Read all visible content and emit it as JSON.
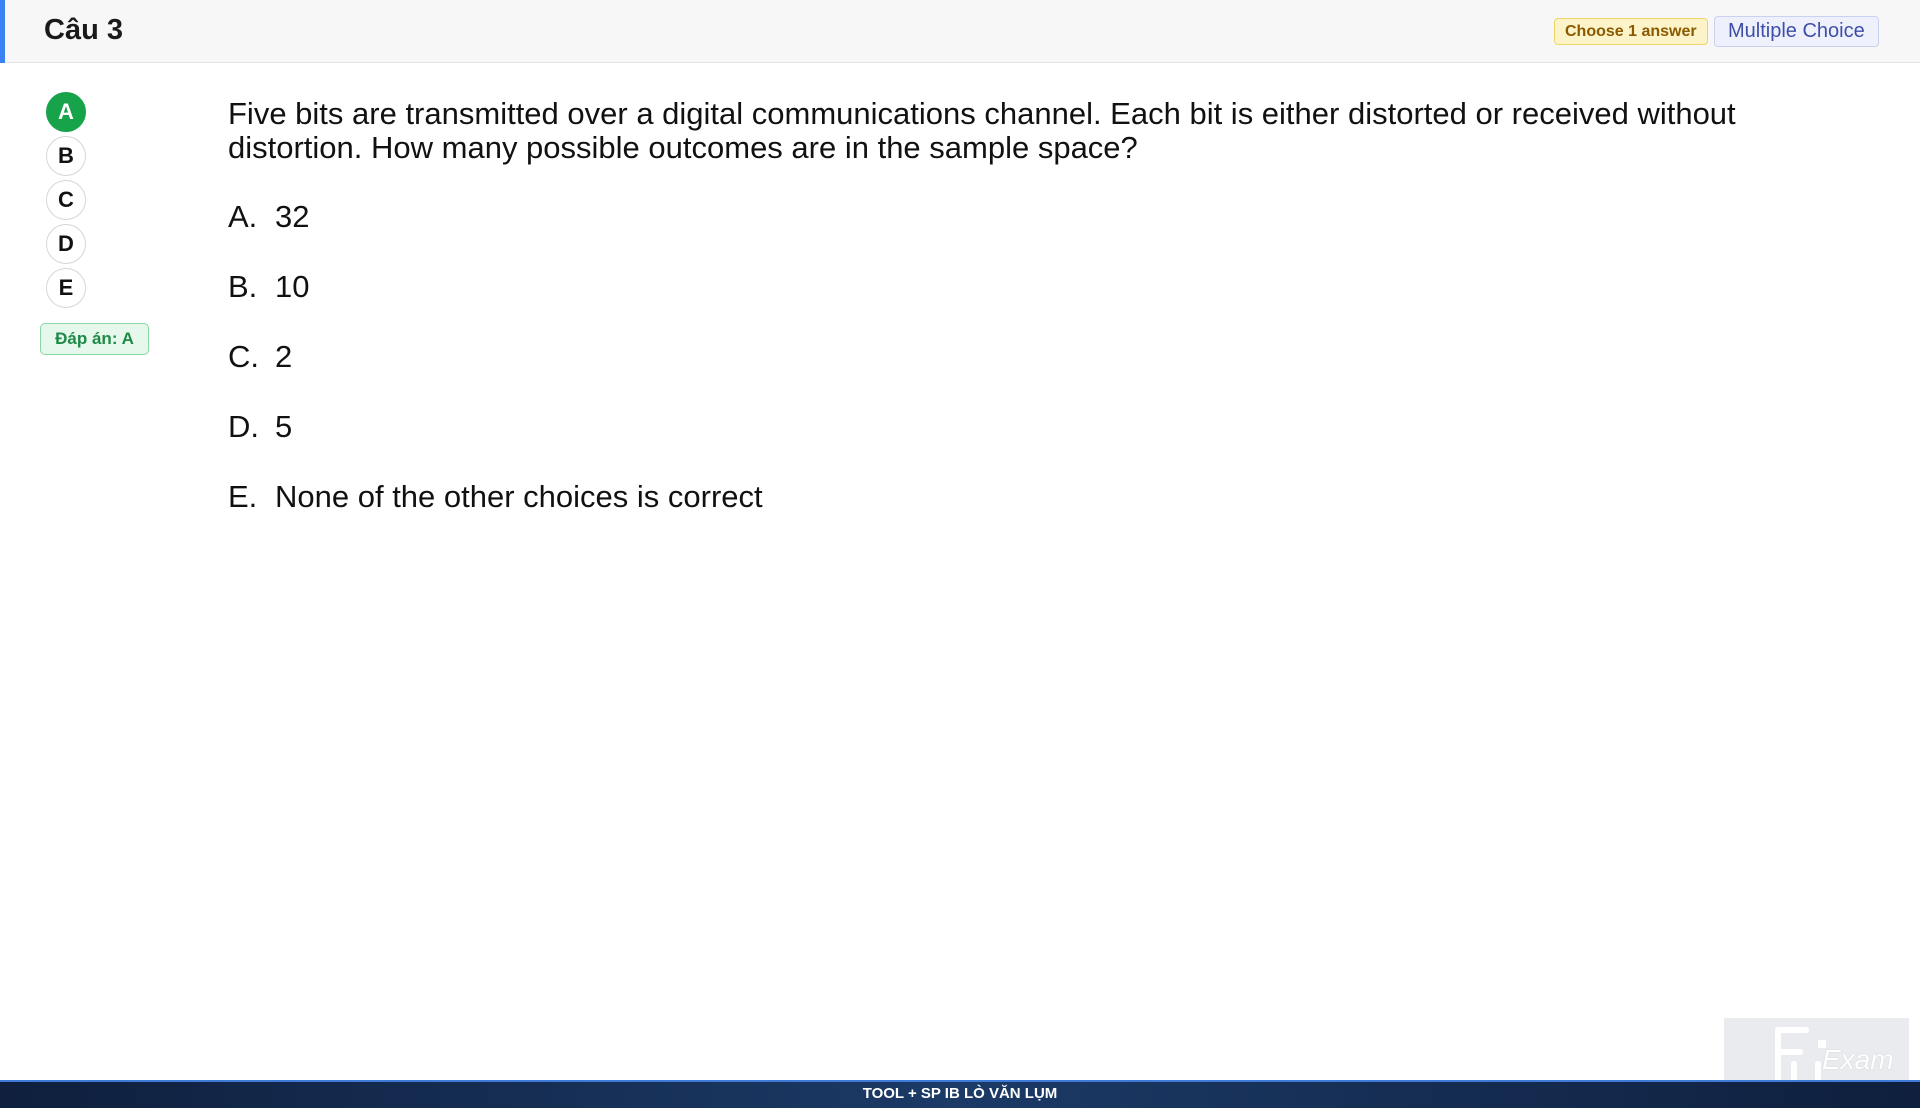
{
  "header": {
    "title": "Câu 3",
    "choose_badge": "Choose 1 answer",
    "type_badge": "Multiple Choice"
  },
  "choices": [
    {
      "label": "A",
      "selected": true
    },
    {
      "label": "B",
      "selected": false
    },
    {
      "label": "C",
      "selected": false
    },
    {
      "label": "D",
      "selected": false
    },
    {
      "label": "E",
      "selected": false
    }
  ],
  "answer_badge": "Đáp án: A",
  "question": {
    "line1": "Five bits are transmitted over a digital communications channel. Each bit is either distorted or received without",
    "line2": "distortion. How many possible outcomes are in the sample space?"
  },
  "options": [
    {
      "letter": "A.",
      "text": "32"
    },
    {
      "letter": "B.",
      "text": "10"
    },
    {
      "letter": "C.",
      "text": "2"
    },
    {
      "letter": "D.",
      "text": "5"
    },
    {
      "letter": "E.",
      "text": "None of the other choices is correct"
    }
  ],
  "footer": {
    "text": "TOOL + SP IB LÒ VĂN LỤM"
  },
  "logo": {
    "text": "Exam"
  },
  "colors": {
    "accent": "#3b82f6",
    "selected": "#16a34a",
    "answer_bg": "#e6f7ec"
  }
}
